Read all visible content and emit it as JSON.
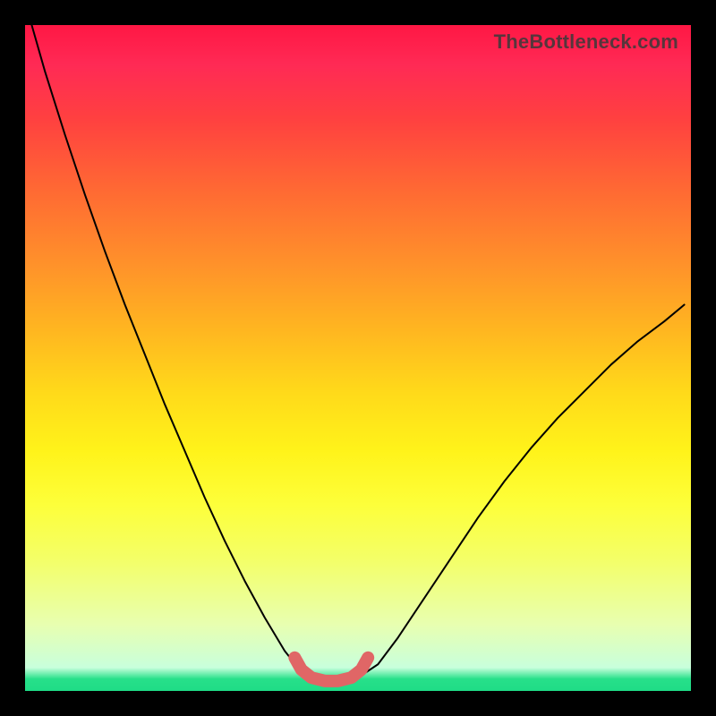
{
  "watermark": {
    "text": "TheBottleneck.com"
  },
  "colors": {
    "frame": "#000000",
    "curve": "#000000",
    "highlight": "#e06666"
  },
  "chart_data": {
    "type": "line",
    "title": "",
    "xlabel": "",
    "ylabel": "",
    "xlim": [
      0,
      1
    ],
    "ylim": [
      0,
      1
    ],
    "grid": false,
    "legend": false,
    "annotations": [],
    "series": [
      {
        "name": "bottleneck-curve",
        "x": [
          0.01,
          0.03,
          0.06,
          0.09,
          0.12,
          0.15,
          0.18,
          0.21,
          0.24,
          0.27,
          0.3,
          0.33,
          0.36,
          0.39,
          0.41,
          0.43,
          0.45,
          0.47,
          0.5,
          0.53,
          0.56,
          0.6,
          0.64,
          0.68,
          0.72,
          0.76,
          0.8,
          0.84,
          0.88,
          0.92,
          0.96,
          0.99
        ],
        "y": [
          1.0,
          0.93,
          0.835,
          0.745,
          0.66,
          0.58,
          0.505,
          0.43,
          0.36,
          0.29,
          0.225,
          0.165,
          0.11,
          0.06,
          0.035,
          0.02,
          0.015,
          0.015,
          0.02,
          0.04,
          0.08,
          0.14,
          0.2,
          0.26,
          0.315,
          0.365,
          0.41,
          0.45,
          0.49,
          0.525,
          0.555,
          0.58
        ]
      },
      {
        "name": "bottleneck-valley-highlight",
        "x": [
          0.405,
          0.415,
          0.43,
          0.45,
          0.47,
          0.49,
          0.505,
          0.515
        ],
        "y": [
          0.05,
          0.032,
          0.02,
          0.015,
          0.015,
          0.02,
          0.032,
          0.05
        ]
      }
    ],
    "gradient_stops": [
      {
        "pos": 0.0,
        "color": "#1fdc86"
      },
      {
        "pos": 0.018,
        "color": "#27e08a"
      },
      {
        "pos": 0.035,
        "color": "#c8ffdc"
      },
      {
        "pos": 0.1,
        "color": "#e8ffb0"
      },
      {
        "pos": 0.2,
        "color": "#f4ff66"
      },
      {
        "pos": 0.28,
        "color": "#fdff3a"
      },
      {
        "pos": 0.36,
        "color": "#fff31a"
      },
      {
        "pos": 0.45,
        "color": "#ffd91a"
      },
      {
        "pos": 0.55,
        "color": "#ffb321"
      },
      {
        "pos": 0.65,
        "color": "#ff8e2b"
      },
      {
        "pos": 0.75,
        "color": "#ff6a33"
      },
      {
        "pos": 0.86,
        "color": "#ff4040"
      },
      {
        "pos": 0.94,
        "color": "#ff2a55"
      },
      {
        "pos": 1.0,
        "color": "#ff1744"
      }
    ]
  }
}
